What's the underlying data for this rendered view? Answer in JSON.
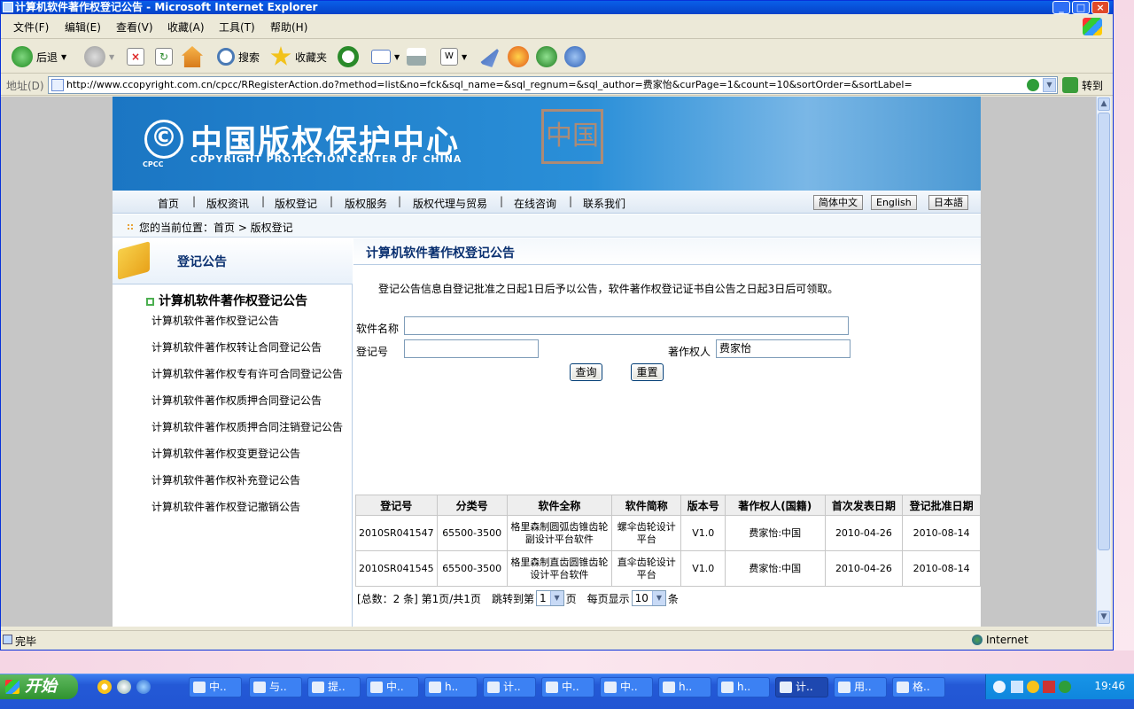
{
  "window": {
    "title": "计算机软件著作权登记公告 - Microsoft Internet Explorer",
    "controls": {
      "minimize": "_",
      "maximize": "□",
      "close": "×"
    }
  },
  "menubar": [
    "文件(F)",
    "编辑(E)",
    "查看(V)",
    "收藏(A)",
    "工具(T)",
    "帮助(H)"
  ],
  "toolbar": {
    "back": "后退",
    "search": "搜索",
    "favorites": "收藏夹"
  },
  "address": {
    "label": "地址(D)",
    "url": "http://www.ccopyright.com.cn/cpcc/RRegisterAction.do?method=list&no=fck&sql_name=&sql_regnum=&sql_author=费家怡&curPage=1&count=10&sortOrder=&sortLabel=",
    "go": "转到"
  },
  "banner": {
    "logo_symbol": "©",
    "logo_abbr": "CPCC",
    "name_cn": "中国版权保护中心",
    "name_en": "COPYRIGHT PROTECTION CENTER OF CHINA",
    "deco_char": "中国"
  },
  "nav": {
    "items": [
      "首页",
      "版权资讯",
      "版权登记",
      "版权服务",
      "版权代理与贸易",
      "在线咨询",
      "联系我们"
    ],
    "separator": "|",
    "langs": [
      "简体中文",
      "English",
      "日本語"
    ]
  },
  "breadcrumb": "您的当前位置：首页 > 版权登记",
  "sidebar": {
    "title": "登记公告",
    "section": "计算机软件著作权登记公告",
    "links": [
      "计算机软件著作权登记公告",
      "计算机软件著作权转让合同登记公告",
      "计算机软件著作权专有许可合同登记公告",
      "计算机软件著作权质押合同登记公告",
      "计算机软件著作权质押合同注销登记公告",
      "计算机软件著作权变更登记公告",
      "计算机软件著作权补充登记公告",
      "计算机软件著作权登记撤销公告"
    ]
  },
  "main": {
    "title": "计算机软件著作权登记公告",
    "notice": "登记公告信息自登记批准之日起1日后予以公告，软件著作权登记证书自公告之日起3日后可领取。",
    "form": {
      "name_label": "软件名称",
      "name_value": "",
      "regnum_label": "登记号",
      "regnum_value": "",
      "author_label": "著作权人",
      "author_value": "费家怡",
      "query": "查询",
      "reset": "重置"
    },
    "table": {
      "headers": [
        "登记号",
        "分类号",
        "软件全称",
        "软件简称",
        "版本号",
        "著作权人(国籍)",
        "首次发表日期",
        "登记批准日期"
      ],
      "rows": [
        [
          "2010SR041547",
          "65500-3500",
          "格里森制圆弧齿锥齿轮副设计平台软件",
          "螺伞齿轮设计平台",
          "V1.0",
          "费家怡:中国",
          "2010-04-26",
          "2010-08-14"
        ],
        [
          "2010SR041545",
          "65500-3500",
          "格里森制直齿圆锥齿轮设计平台软件",
          "直伞齿轮设计平台",
          "V1.0",
          "费家怡:中国",
          "2010-04-26",
          "2010-08-14"
        ]
      ]
    },
    "pager": {
      "total": "[总数：2 条] 第1页/共1页",
      "jump_prefix": "跳转到第",
      "page_value": "1",
      "jump_suffix": "页",
      "per_prefix": "每页显示",
      "per_value": "10",
      "per_suffix": "条"
    }
  },
  "status": {
    "text": "完毕",
    "zone": "Internet"
  },
  "taskbar": {
    "start": "开始",
    "tasks": [
      "中..",
      "与..",
      "提..",
      "中..",
      "h..",
      "计..",
      "中..",
      "中..",
      "h..",
      "h..",
      "计..",
      "用..",
      "格.."
    ],
    "active_index": 10,
    "clock": "19:46"
  }
}
